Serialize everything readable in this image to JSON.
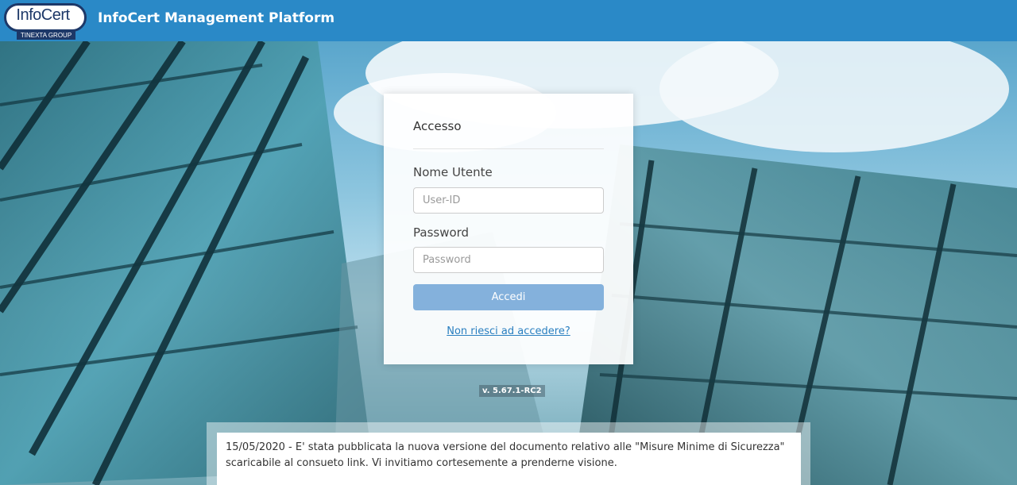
{
  "header": {
    "logo_text": "InfoCert",
    "logo_subtext": "TINEXTA GROUP",
    "title": "InfoCert Management Platform"
  },
  "login": {
    "title": "Accesso",
    "username_label": "Nome Utente",
    "username_placeholder": "User-ID",
    "username_value": "",
    "password_label": "Password",
    "password_placeholder": "Password",
    "password_value": "",
    "submit_label": "Accedi",
    "help_link": "Non riesci ad accedere?"
  },
  "version": "v. 5.67.1-RC2",
  "notice": {
    "text": "15/05/2020 - E' stata pubblicata la nuova versione del documento relativo alle \"Misure Minime di Sicurezza\" scaricabile al consueto link. Vi invitiamo cortesemente a prenderne visione."
  },
  "colors": {
    "header": "#2a89c7",
    "button": "#84b1dc",
    "link": "#2a7fc0",
    "logo_blue": "#1d3868"
  }
}
